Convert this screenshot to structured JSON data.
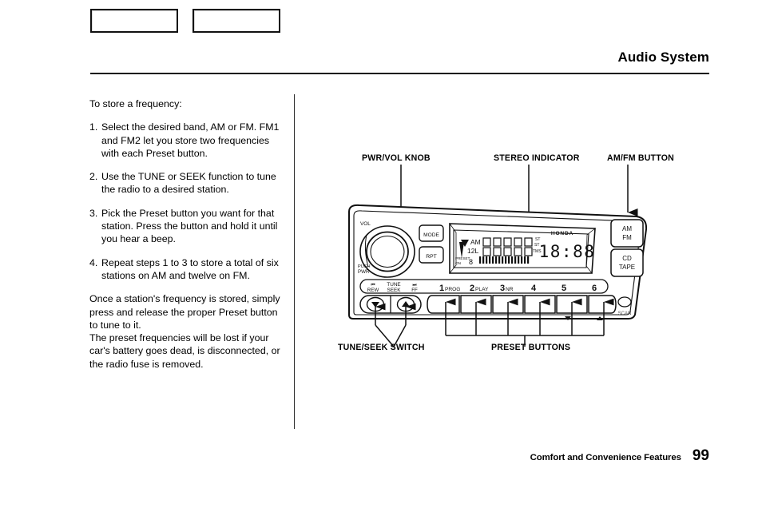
{
  "header": {
    "tabs": [
      {
        "label": ""
      },
      {
        "label": ""
      }
    ],
    "title": "Audio System"
  },
  "content": {
    "intro": "To store a frequency:",
    "steps": [
      {
        "num": "1.",
        "text": "Select the desired band, AM or FM. FM1 and FM2 let you store two frequencies with each Preset button."
      },
      {
        "num": "2.",
        "text": "Use the TUNE or SEEK function to tune the radio to a desired station."
      },
      {
        "num": "3.",
        "text": "Pick the Preset button you want for that station. Press the button and hold it until you hear a beep."
      },
      {
        "num": "4.",
        "text": "Repeat steps 1 to 3 to store a total of six stations on AM and twelve on FM."
      }
    ],
    "closing_1": "Once a station's frequency is stored, simply press and release the proper Preset button to tune to it.",
    "closing_2": "The preset frequencies will be lost if your car's battery goes dead, is disconnected, or the radio fuse is removed."
  },
  "figure": {
    "callouts": {
      "pwr_vol_knob": "PWR/VOL KNOB",
      "stereo_indicator": "STEREO INDICATOR",
      "am_fm_button": "AM/FM BUTTON",
      "tune_seek_switch": "TUNE/SEEK SWITCH",
      "preset_buttons": "PRESET BUTTONS"
    },
    "radio": {
      "brand": "HONDA",
      "knob_top_label": "VOL",
      "knob_bottom_label_1": "PUSH",
      "knob_bottom_label_2": "PWR",
      "mode_button": "MODE",
      "rpt_button": "RPT",
      "am_fm_button_line1": "AM",
      "am_fm_button_line2": "FM",
      "cd_tape_button_line1": "CD",
      "cd_tape_button_line2": "TAPE",
      "scan_label": "SCAN",
      "tune_seek_labels": {
        "rew_icon": "REW",
        "tune": "TUNE",
        "seek": "SEEK",
        "ff_icon": "FF"
      },
      "preset_labels": [
        {
          "num": "1",
          "sub": "PROG"
        },
        {
          "num": "2",
          "sub": "PLAY"
        },
        {
          "num": "3",
          "sub": "NR"
        },
        {
          "num": "4",
          "sub": ""
        },
        {
          "num": "5",
          "sub": ""
        },
        {
          "num": "6",
          "sub": ""
        }
      ],
      "display": {
        "band": "AM",
        "fm_line": "12L",
        "preset_row": "PRESET",
        "on_label": "ON",
        "st_label": "ST",
        "tms_label": "TMS",
        "clock": "18:88"
      }
    }
  },
  "footer": {
    "section": "Comfort and Convenience Features",
    "page": "99"
  }
}
